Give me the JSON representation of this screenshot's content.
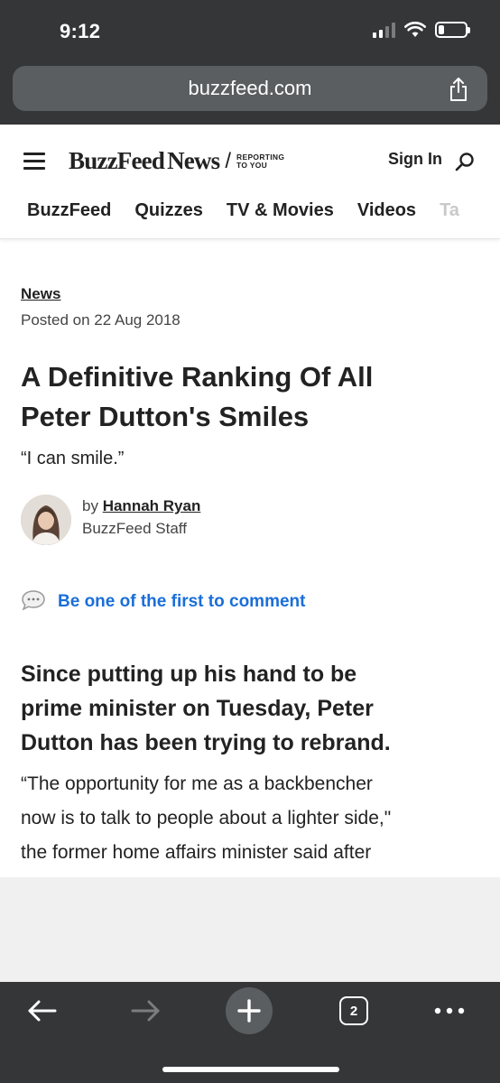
{
  "status_bar": {
    "time": "9:12"
  },
  "browser": {
    "url": "buzzfeed.com",
    "tab_count": "2"
  },
  "site": {
    "logo_buzzfeed": "BuzzFeed",
    "logo_news": "News",
    "logo_tagline_1": "REPORTING",
    "logo_tagline_2": "TO YOU",
    "sign_in": "Sign In",
    "nav": [
      "BuzzFeed",
      "Quizzes",
      "TV & Movies",
      "Videos",
      "Ta"
    ]
  },
  "article": {
    "category": "News",
    "posted": "Posted on 22 Aug 2018",
    "headline_1": "A Definitive Ranking Of All",
    "headline_2": "Peter Dutton's Smiles",
    "dek": "“I can smile.”",
    "byline_prefix": "by",
    "author": "Hannah Ryan",
    "author_role": "BuzzFeed Staff",
    "comment_link": "Be one of the first to comment",
    "subhead_1": "Since putting up his hand to be",
    "subhead_2": "prime minister on Tuesday, Peter",
    "subhead_3": "Dutton has been trying to rebrand.",
    "body_1": "“The opportunity for me as a backbencher",
    "body_2": "now is to talk to people about a lighter side,\"",
    "body_3": "the former home affairs minister said after"
  },
  "colors": {
    "link_blue": "#1a6ed8",
    "chrome": "#343638",
    "text": "#222222"
  }
}
